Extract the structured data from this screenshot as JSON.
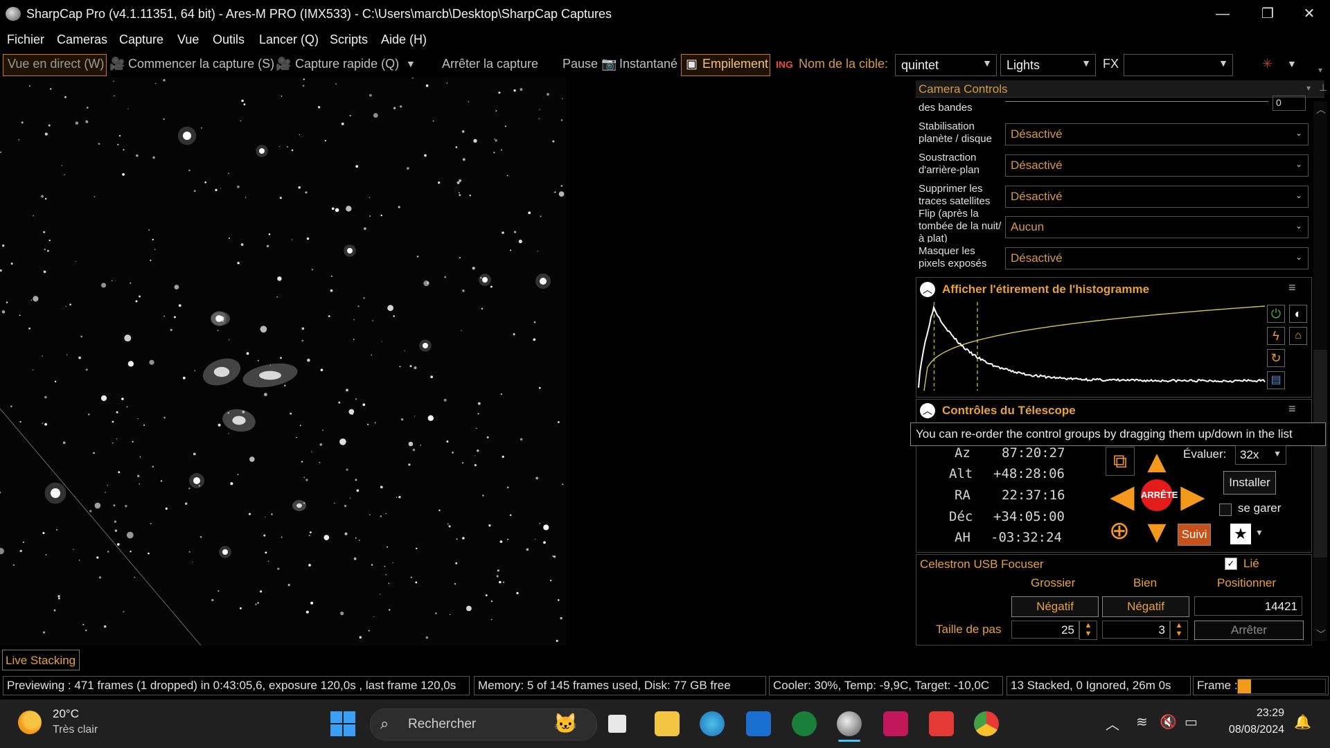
{
  "window": {
    "title": "SharpCap Pro (v4.1.11351, 64 bit) - Ares-M PRO (IMX533) - C:\\Users\\marcb\\Desktop\\SharpCap Captures",
    "minimize": "—",
    "restore": "❐",
    "close": "✕"
  },
  "menu": [
    "Fichier",
    "Cameras",
    "Capture",
    "Vue",
    "Outils",
    "Lancer (Q)",
    "Scripts",
    "Aide (H)"
  ],
  "toolbar": {
    "live_view": "Vue en direct (W)",
    "start_capture": "Commencer la capture (S)",
    "quick_capture": "Capture rapide (Q)",
    "stop_capture": "Arrêter la capture",
    "pause": "Pause",
    "snapshot": "Instantané",
    "stacking": "Empilement",
    "target_label": "Nom de la cible:",
    "target_value": "quintet",
    "frame_type": "Lights",
    "fx_label": "FX",
    "fx_value": ""
  },
  "camera_controls": {
    "header": "Camera Controls",
    "partial_label": "des bandes",
    "partial_value": "0",
    "rows": [
      {
        "label": "Stabilisation planète / disque",
        "value": "Désactivé"
      },
      {
        "label": "Soustraction d'arrière-plan",
        "value": "Désactivé"
      },
      {
        "label": "Supprimer les traces satellites",
        "value": "Désactivé"
      },
      {
        "label": "Flip (après la tombée de la nuit/à plat)",
        "value": "Aucun"
      },
      {
        "label": "Masquer les pixels exposés",
        "value": "Désactivé"
      }
    ]
  },
  "histogram": {
    "title": "Afficher l'étirement de l'histogramme",
    "black_point": 0.045,
    "mid_point": 0.17
  },
  "telescope": {
    "title": "Contrôles du Télescope",
    "tooltip": "You can re-order the control groups by dragging them up/down in the list",
    "rows": [
      {
        "label": "Az",
        "value": "87:20:27"
      },
      {
        "label": "Alt",
        "value": "+48:28:06"
      },
      {
        "label": "RA",
        "value": "22:37:16"
      },
      {
        "label": "Déc",
        "value": "+34:05:00"
      },
      {
        "label": "AH",
        "value": "-03:32:24"
      }
    ],
    "stop_label": "ARRÊTE",
    "rate_label": "Évaluer:",
    "rate_value": "32x",
    "install": "Installer",
    "park": "se garer",
    "track": "Suivi"
  },
  "focuser": {
    "title": "Celestron USB Focuser",
    "linked": "Lié",
    "col_coarse": "Grossier",
    "col_fine": "Bien",
    "col_position": "Positionner",
    "coarse_btn": "Négatif",
    "fine_btn": "Négatif",
    "position": "14421",
    "step_label": "Taille de pas",
    "coarse_step": "25",
    "fine_step": "3",
    "stop": "Arrêter"
  },
  "live_stacking_tab": "Live Stacking",
  "status": {
    "preview": "Previewing : 471 frames (1 dropped) in 0:43:05,6, exposure 120,0s , last frame 120,0s",
    "memory": "Memory: 5 of 145 frames used, Disk: 77 GB free",
    "cooler": "Cooler: 30%, Temp: -9,9C, Target: -10,0C",
    "stacked": "13 Stacked, 0 Ignored, 26m 0s",
    "frame": "Frame :",
    "frame_progress": 0.15
  },
  "taskbar": {
    "temp": "20°C",
    "weather": "Très clair",
    "search": "Rechercher",
    "time": "23:29",
    "date": "08/08/2024"
  }
}
